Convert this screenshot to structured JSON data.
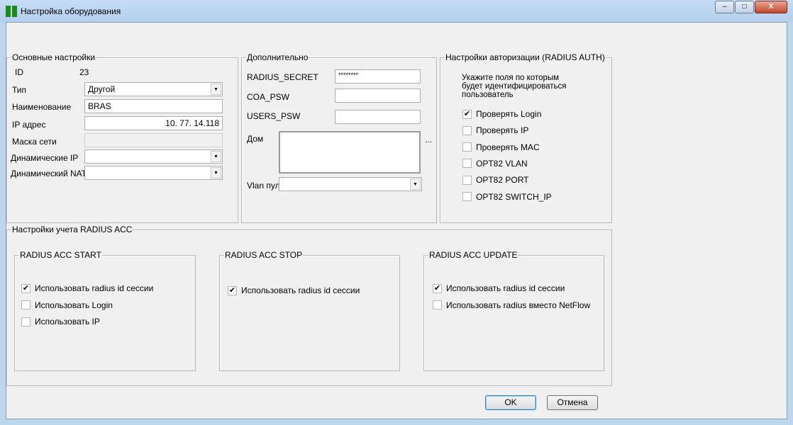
{
  "window": {
    "title": "Настройка оборудования"
  },
  "basic": {
    "legend": "Основные настройки",
    "id_label": "ID",
    "id_value": "23",
    "type_label": "Тип",
    "type_value": "Другой",
    "name_label": "Наименование",
    "name_value": "BRAS",
    "ip_label": "IP адрес",
    "ip_value": "10. 77. 14.118",
    "mask_label": "Маска сети",
    "mask_value": "",
    "dyn_ip_label": "Динамические IP",
    "dyn_ip_value": "",
    "dyn_nat_label": "Динамический NAT",
    "dyn_nat_value": ""
  },
  "extra": {
    "legend": "Дополнительно",
    "radius_secret_label": "RADIUS_SECRET",
    "radius_secret_value": "********",
    "coa_label": "COA_PSW",
    "coa_value": "",
    "users_label": "USERS_PSW",
    "users_value": "",
    "house_label": "Дом",
    "house_value": "",
    "house_more": "...",
    "vlan_label": "Vlan пул",
    "vlan_value": ""
  },
  "auth": {
    "legend": "Настройки авторизации (RADIUS AUTH)",
    "hint": "Укажите поля по которым будет идентифицироваться пользователь",
    "options": [
      {
        "label": "Проверять Login",
        "checked": true
      },
      {
        "label": "Проверять IP",
        "checked": false
      },
      {
        "label": "Проверять MAC",
        "checked": false
      },
      {
        "label": "OPT82 VLAN",
        "checked": false
      },
      {
        "label": "OPT82 PORT",
        "checked": false
      },
      {
        "label": "OPT82 SWITCH_IP",
        "checked": false
      }
    ]
  },
  "acc": {
    "legend": "Настройки учета RADIUS ACC",
    "start": {
      "legend": "RADIUS ACC START",
      "options": [
        {
          "label": "Использовать radius id сессии",
          "checked": true
        },
        {
          "label": "Использовать Login",
          "checked": false
        },
        {
          "label": "Использовать IP",
          "checked": false
        }
      ]
    },
    "stop": {
      "legend": "RADIUS ACC STOP",
      "options": [
        {
          "label": "Использовать radius id сессии",
          "checked": true
        }
      ]
    },
    "update": {
      "legend": "RADIUS ACC UPDATE",
      "options": [
        {
          "label": "Использовать radius id сессии",
          "checked": true
        },
        {
          "label": "Использовать radius вместо NetFlow",
          "checked": false
        }
      ]
    }
  },
  "buttons": {
    "ok": "OK",
    "cancel": "Отмена"
  },
  "glyphs": {
    "check": "✔",
    "arrow": "▼",
    "min": "–",
    "max": "□",
    "close": "X"
  }
}
